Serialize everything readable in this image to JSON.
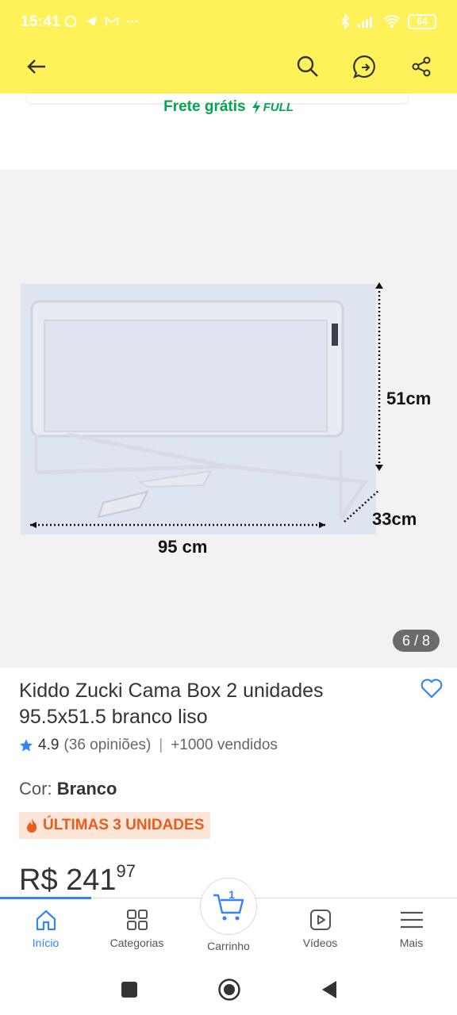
{
  "status_bar": {
    "time": "15:41",
    "battery": "64",
    "left_icons": [
      "whatsapp-icon",
      "telegram-icon",
      "gmail-icon",
      "more-dots-icon"
    ],
    "right_icons": [
      "bluetooth-icon",
      "signal-icon",
      "wifi-icon",
      "battery-icon"
    ]
  },
  "app_bar": {
    "buttons": [
      "back-icon",
      "search-icon",
      "whatsapp-share-icon",
      "share-icon"
    ],
    "background": "#fff159"
  },
  "shipping": {
    "label": "Frete grátis",
    "badge": "FULL",
    "color": "#00a650"
  },
  "gallery": {
    "dimension_height": "51cm",
    "dimension_depth": "33cm",
    "dimension_width": "95 cm",
    "pager": "6 / 8"
  },
  "product": {
    "title": "Kiddo Zucki Cama Box 2 unidades 95.5x51.5 branco liso",
    "rating": "4.9",
    "reviews": "(36 opiniões)",
    "separator": "|",
    "sold": "+1000 vendidos",
    "color_label": "Cor:",
    "color_value": "Branco",
    "stock_badge": "ÚLTIMAS 3 UNIDADES",
    "price_currency": "R$",
    "price_integer": "241",
    "price_cents": "97"
  },
  "bottom_nav": {
    "items": [
      {
        "label": "Início",
        "icon": "home-icon",
        "active": true
      },
      {
        "label": "Categorias",
        "icon": "categories-icon",
        "active": false
      },
      {
        "label": "Carrinho",
        "icon": "cart-icon",
        "badge": "1",
        "active": false
      },
      {
        "label": "Vídeos",
        "icon": "video-icon",
        "active": false
      },
      {
        "label": "Mais",
        "icon": "menu-icon",
        "active": false
      }
    ],
    "accent": "#3483fa"
  },
  "system_nav": [
    "square-icon",
    "home-circle-icon",
    "back-triangle-icon"
  ]
}
